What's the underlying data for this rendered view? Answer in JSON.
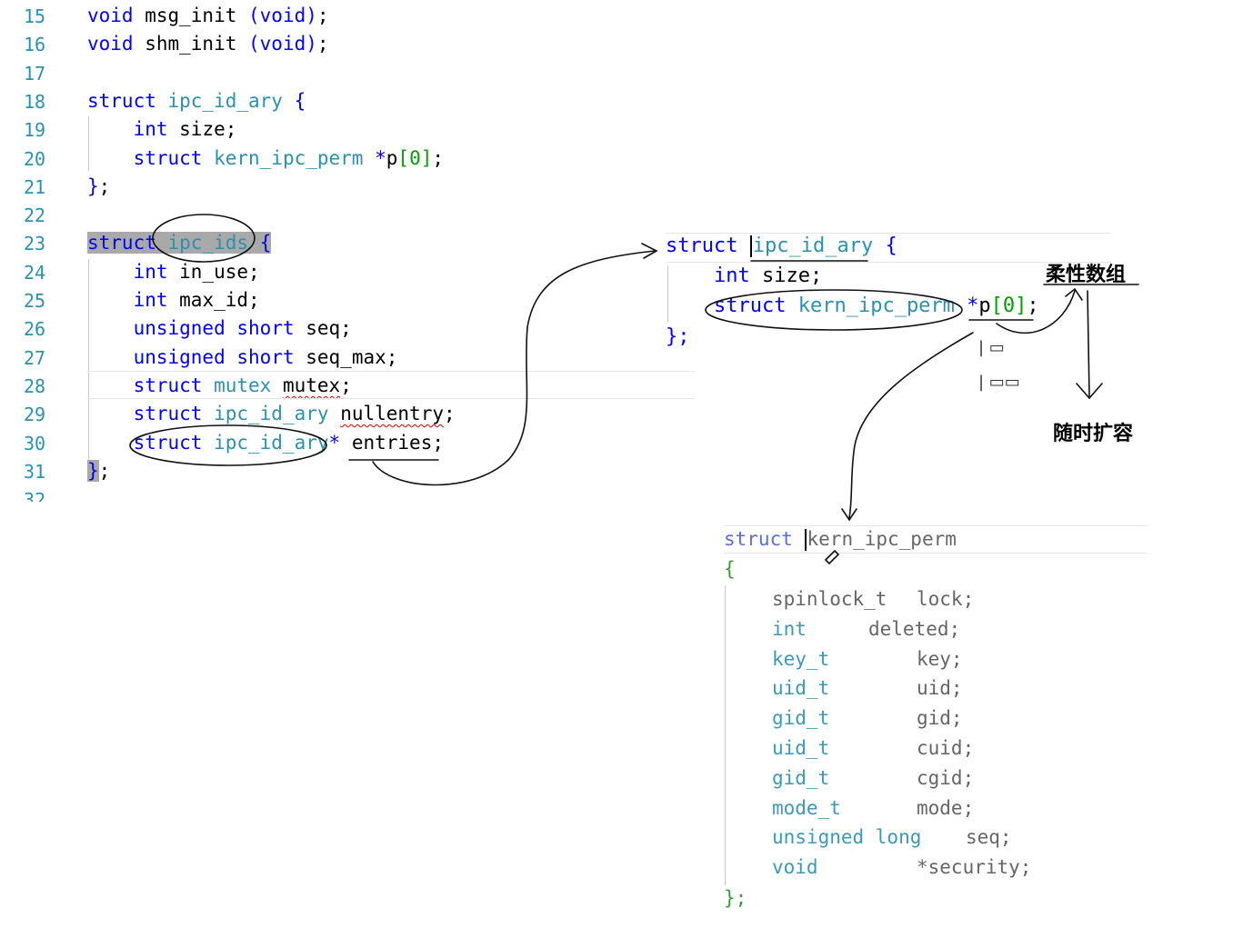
{
  "editor": {
    "lines": [
      {
        "num": "15",
        "tokens": [
          {
            "t": "void",
            "c": "kw"
          },
          {
            "t": " msg_init "
          },
          {
            "t": "(void)",
            "c": "kw"
          },
          {
            "t": ";"
          }
        ]
      },
      {
        "num": "16",
        "tokens": [
          {
            "t": "void",
            "c": "kw"
          },
          {
            "t": " shm_init "
          },
          {
            "t": "(void)",
            "c": "kw"
          },
          {
            "t": ";"
          }
        ]
      },
      {
        "num": "17",
        "tokens": []
      },
      {
        "num": "18",
        "tokens": [
          {
            "t": "struct",
            "c": "kw"
          },
          {
            "t": " "
          },
          {
            "t": "ipc_id_ary",
            "c": "ty"
          },
          {
            "t": " {",
            "c": "kw"
          }
        ]
      },
      {
        "num": "19",
        "tokens": [
          {
            "t": "    "
          },
          {
            "t": "int",
            "c": "kw"
          },
          {
            "t": " size;"
          }
        ]
      },
      {
        "num": "20",
        "tokens": [
          {
            "t": "    "
          },
          {
            "t": "struct",
            "c": "kw"
          },
          {
            "t": " "
          },
          {
            "t": "kern_ipc_perm",
            "c": "ty"
          },
          {
            "t": " *",
            "c": "kw"
          },
          {
            "t": "p"
          },
          {
            "t": "[0]",
            "c": "br"
          },
          {
            "t": ";"
          }
        ]
      },
      {
        "num": "21",
        "tokens": [
          {
            "t": "}",
            "c": "kw"
          },
          {
            "t": ";"
          }
        ]
      },
      {
        "num": "22",
        "tokens": []
      },
      {
        "num": "23",
        "tokens": [
          {
            "t": "struct",
            "c": "kw",
            "h": 1
          },
          {
            "t": " ",
            "h": 1
          },
          {
            "t": "ipc_ids",
            "c": "ty",
            "h": 1
          },
          {
            "t": " ",
            "h": 1
          },
          {
            "t": "{",
            "c": "kw",
            "h": 1
          }
        ]
      },
      {
        "num": "24",
        "tokens": [
          {
            "t": "    "
          },
          {
            "t": "int",
            "c": "kw"
          },
          {
            "t": " in_use;"
          }
        ]
      },
      {
        "num": "25",
        "tokens": [
          {
            "t": "    "
          },
          {
            "t": "int",
            "c": "kw"
          },
          {
            "t": " max_id;"
          }
        ]
      },
      {
        "num": "26",
        "tokens": [
          {
            "t": "    "
          },
          {
            "t": "unsigned",
            "c": "kw"
          },
          {
            "t": " "
          },
          {
            "t": "short",
            "c": "kw"
          },
          {
            "t": " seq;"
          }
        ]
      },
      {
        "num": "27",
        "tokens": [
          {
            "t": "    "
          },
          {
            "t": "unsigned",
            "c": "kw"
          },
          {
            "t": " "
          },
          {
            "t": "short",
            "c": "kw"
          },
          {
            "t": " seq_max;"
          }
        ]
      },
      {
        "num": "28",
        "tokens": [
          {
            "t": "    "
          },
          {
            "t": "struct",
            "c": "kw"
          },
          {
            "t": " "
          },
          {
            "t": "mutex",
            "c": "ty"
          },
          {
            "t": " "
          },
          {
            "t": "mutex",
            "s": 1
          },
          {
            "t": ";"
          }
        ]
      },
      {
        "num": "29",
        "tokens": [
          {
            "t": "    "
          },
          {
            "t": "struct",
            "c": "kw"
          },
          {
            "t": " "
          },
          {
            "t": "ipc_id_ary",
            "c": "ty"
          },
          {
            "t": " "
          },
          {
            "t": "nullentry",
            "s": 1
          },
          {
            "t": ";"
          }
        ]
      },
      {
        "num": "30",
        "tokens": [
          {
            "t": "    "
          },
          {
            "t": "struct",
            "c": "kw"
          },
          {
            "t": " "
          },
          {
            "t": "ipc_id_ary",
            "c": "ty"
          },
          {
            "t": "*",
            "c": "kw"
          },
          {
            "t": " entries;"
          }
        ]
      },
      {
        "num": "31",
        "tokens": [
          {
            "t": "}",
            "c": "kw",
            "h": 1
          },
          {
            "t": ";"
          }
        ]
      },
      {
        "num": "32",
        "tokens": []
      }
    ]
  },
  "snippet_ipc_id_ary": {
    "line1": {
      "kw": "struct",
      "name": "ipc_id_ary",
      "brace": "{"
    },
    "line2": {
      "kw": "int",
      "rest": "size;"
    },
    "line3": {
      "kw": "struct",
      "type": "kern_ipc_perm",
      "star": "*",
      "rest": "p",
      "idx": "[0]",
      "semi": ";"
    },
    "line4": "};"
  },
  "snippet_kern_ipc_perm": {
    "header": {
      "kw": "struct",
      "name": "kern_ipc_perm"
    },
    "open": "{",
    "fields": [
      {
        "type": "spinlock_t",
        "name": "lock;",
        "plain": true
      },
      {
        "type": "int",
        "name": "deleted;"
      },
      {
        "type": "key_t",
        "name": "key;"
      },
      {
        "type": "uid_t",
        "name": "uid;"
      },
      {
        "type": "gid_t",
        "name": "gid;"
      },
      {
        "type": "uid_t",
        "name": "cuid;"
      },
      {
        "type": "gid_t",
        "name": "cgid;"
      },
      {
        "type": "mode_t",
        "name": "mode;"
      },
      {
        "type": "unsigned long",
        "name": "seq;"
      },
      {
        "type": "void",
        "name": "*security;"
      }
    ],
    "close": "};"
  },
  "annotations": {
    "flexible_array": "柔性数组",
    "resize_anytime": "随时扩容",
    "scribble_1": "| ▭",
    "scribble_2": "| ▭▭"
  }
}
